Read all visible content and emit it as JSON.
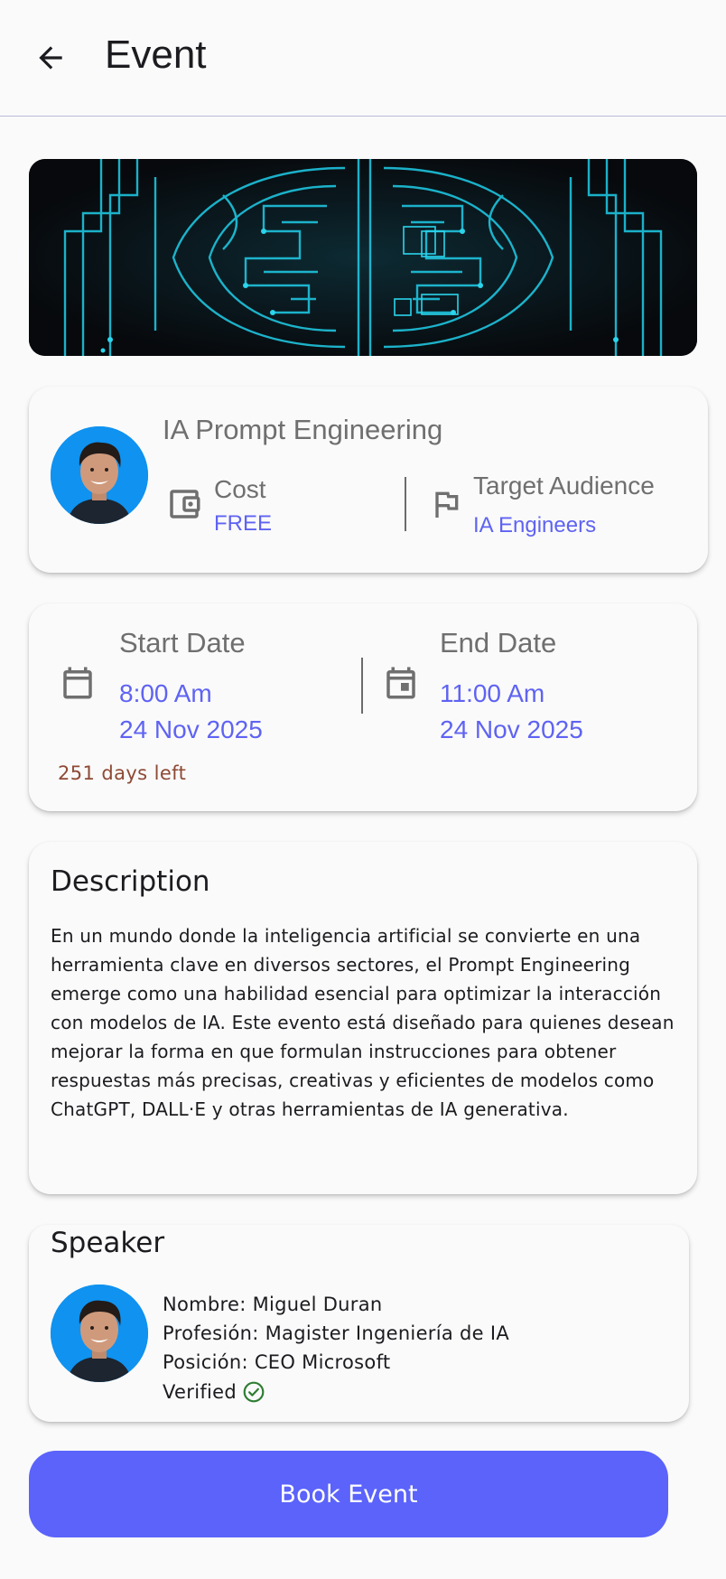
{
  "appbar": {
    "title": "Event",
    "back_icon": "arrow-left-icon"
  },
  "banner": {
    "image": "circuit-brain-image"
  },
  "event": {
    "name": "IA Prompt Engineering",
    "cost_label": "Cost",
    "cost_value": "FREE",
    "audience_label": "Target Audience",
    "audience_value": "IA Engineers",
    "icons": [
      "wallet-icon",
      "flag-icon"
    ]
  },
  "dates": {
    "start_label": "Start Date",
    "start_time": "8:00 Am",
    "start_date": "24 Nov 2025",
    "end_label": "End Date",
    "end_time": "11:00 Am",
    "end_date": "24 Nov 2025",
    "days_left": "251 days left"
  },
  "description": {
    "title": "Description",
    "text": "En un mundo donde la inteligencia artificial se convierte en una herramienta clave en diversos sectores, el Prompt Engineering emerge como una habilidad esencial para optimizar la interacción con modelos de IA. Este evento está diseñado para quienes desean mejorar la forma en que formulan instrucciones para obtener respuestas más precisas, creativas y eficientes de modelos como ChatGPT, DALL·E y otras herramientas de IA generativa."
  },
  "speaker": {
    "title": "Speaker",
    "name": "Nombre: Miguel Duran",
    "profession": "Profesión: Magister Ingeniería de IA",
    "position": "Posición: CEO Microsoft",
    "verified": "Verified"
  },
  "actions": {
    "book_label": "Book Event"
  },
  "colors": {
    "accent": "#5b63fb",
    "link": "#5f63f2",
    "warning": "#8e4a35",
    "verified": "#2e7d32"
  }
}
